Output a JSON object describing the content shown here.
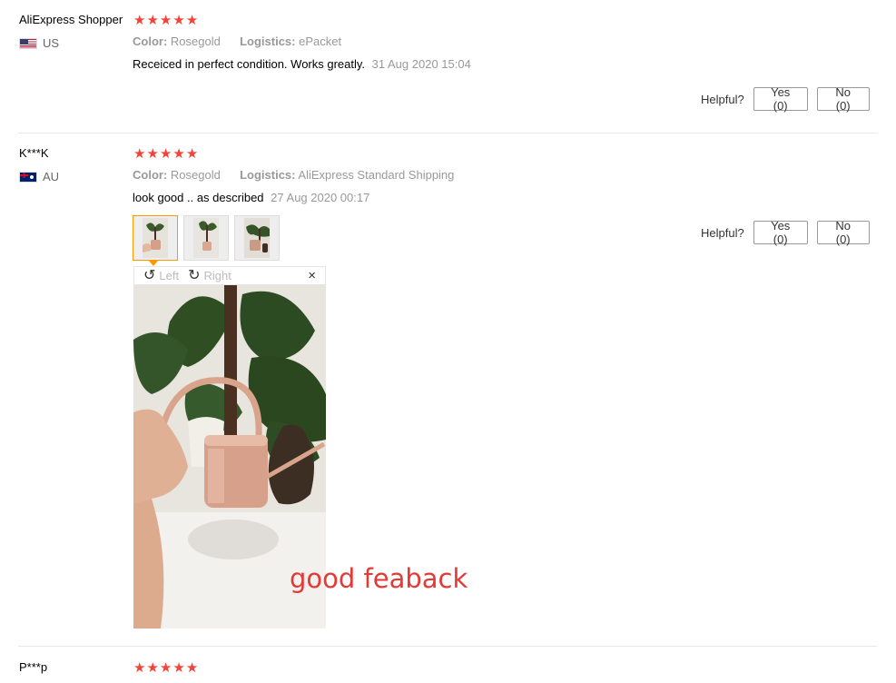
{
  "reviews": [
    {
      "user": "AliExpress Shopper",
      "country": "US",
      "flag": "us-flag",
      "stars": 5,
      "color_label": "Color:",
      "color_value": "Rosegold",
      "logistics_label": "Logistics:",
      "logistics_value": "ePacket",
      "text": "Receiced in perfect condition. Works greatly.",
      "date": "31 Aug 2020 15:04",
      "helpful_label": "Helpful?",
      "yes_label": "Yes (0)",
      "no_label": "No (0)"
    },
    {
      "user": "K***K",
      "country": "AU",
      "flag": "au-flag",
      "stars": 5,
      "color_label": "Color:",
      "color_value": "Rosegold",
      "logistics_label": "Logistics:",
      "logistics_value": "AliExpress Standard Shipping",
      "text": "look good .. as described",
      "date": "27 Aug 2020 00:17",
      "helpful_label": "Helpful?",
      "yes_label": "Yes (0)",
      "no_label": "No (0)",
      "photo_count": 3,
      "viewer": {
        "rotate_left": "Left",
        "rotate_right": "Right",
        "close": "×"
      }
    },
    {
      "user": "P***p",
      "stars": 5
    }
  ],
  "overlay_text": "good feaback",
  "colors": {
    "star": "#f44336",
    "active_thumb": "#ff9900",
    "overlay_text": "#e53935"
  }
}
